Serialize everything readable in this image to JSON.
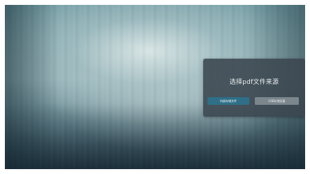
{
  "dialog": {
    "title": "选择pdf文件来源",
    "buttons": {
      "internal": "内部存储文件",
      "usb": "USB存储设备"
    }
  },
  "colors": {
    "dialog_background": "#3a464e",
    "selected_button": "#2f6f87",
    "unselected_button": "#7b878d",
    "title_text": "#e9eef0"
  }
}
